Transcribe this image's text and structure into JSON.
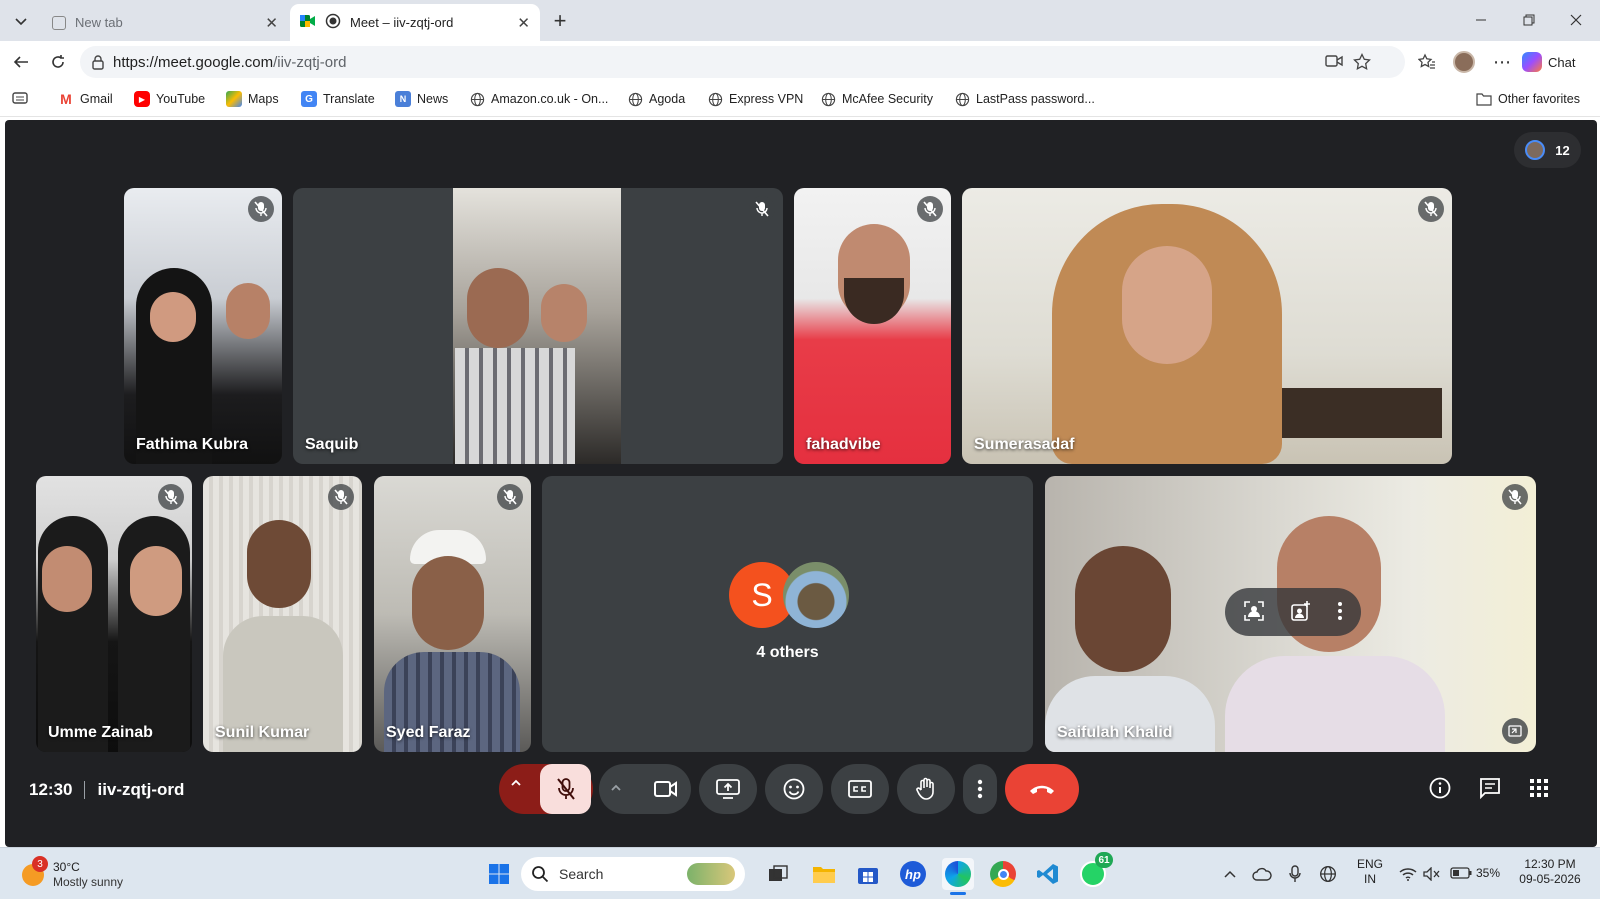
{
  "browser": {
    "tabs": [
      {
        "title": "New tab"
      },
      {
        "title": "Meet – iiv-zqtj-ord"
      }
    ],
    "url_host": "https://meet.google.com",
    "url_path": "/iiv-zqtj-ord",
    "chat_label": "Chat",
    "bookmarks": [
      "Gmail",
      "YouTube",
      "Maps",
      "Translate",
      "News",
      "Amazon.co.uk - On...",
      "Agoda",
      "Express VPN",
      "McAfee Security",
      "LastPass password..."
    ],
    "other_favorites": "Other favorites"
  },
  "meet": {
    "participant_count": "12",
    "tiles": [
      {
        "name": "Fathima Kubra"
      },
      {
        "name": "Saquib"
      },
      {
        "name": "fahadvibe"
      },
      {
        "name": "Sumerasadaf"
      },
      {
        "name": "Umme Zainab"
      },
      {
        "name": "Sunil Kumar"
      },
      {
        "name": "Syed Faraz"
      },
      {
        "name": "Saifulah Khalid"
      }
    ],
    "others": {
      "avatar_letter": "S",
      "label": "4 others"
    },
    "time": "12:30",
    "meeting_code": "iiv-zqtj-ord",
    "colors": {
      "accent_red": "#ea4335",
      "bg": "#202124",
      "control": "#3c4043"
    }
  },
  "taskbar": {
    "weather_temp": "30°C",
    "weather_desc": "Mostly sunny",
    "weather_badge": "3",
    "search_label": "Search",
    "whatsapp_badge": "61",
    "lang_top": "ENG",
    "lang_bottom": "IN",
    "battery": "35%",
    "clock_time": "12:30 PM",
    "clock_date": "09-05-2026"
  }
}
